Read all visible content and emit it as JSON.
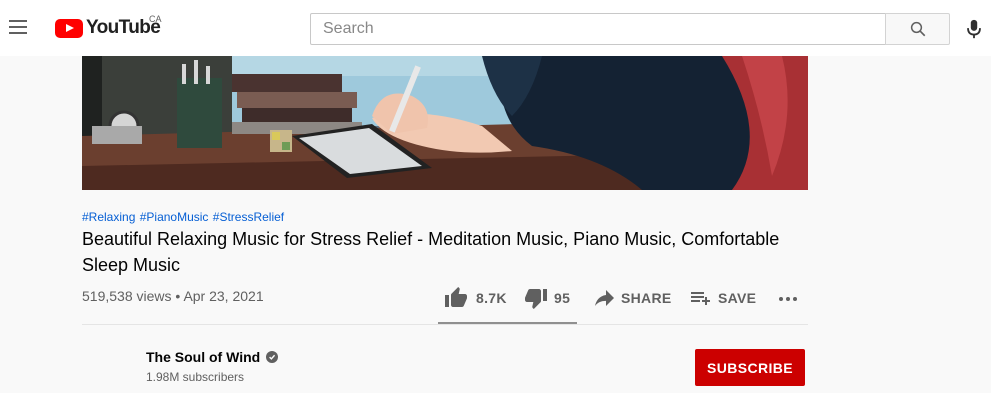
{
  "header": {
    "logo_text": "YouTube",
    "country": "CA",
    "search_placeholder": "Search"
  },
  "video": {
    "hashtags": [
      "#Relaxing",
      "#PianoMusic",
      "#StressRelief"
    ],
    "title": "Beautiful Relaxing Music for Stress Relief - Meditation Music, Piano Music, Comfortable Sleep Music",
    "views": "519,538 views",
    "separator": "•",
    "date": "Apr 23, 2021"
  },
  "actions": {
    "likes": "8.7K",
    "dislikes": "95",
    "share_label": "SHARE",
    "save_label": "SAVE"
  },
  "channel": {
    "name": "The Soul of Wind",
    "subscribers": "1.98M subscribers",
    "subscribe_label": "SUBSCRIBE"
  },
  "colors": {
    "brand_red": "#ff0000",
    "subscribe_red": "#cc0000",
    "hashtag_blue": "#065fd4"
  }
}
